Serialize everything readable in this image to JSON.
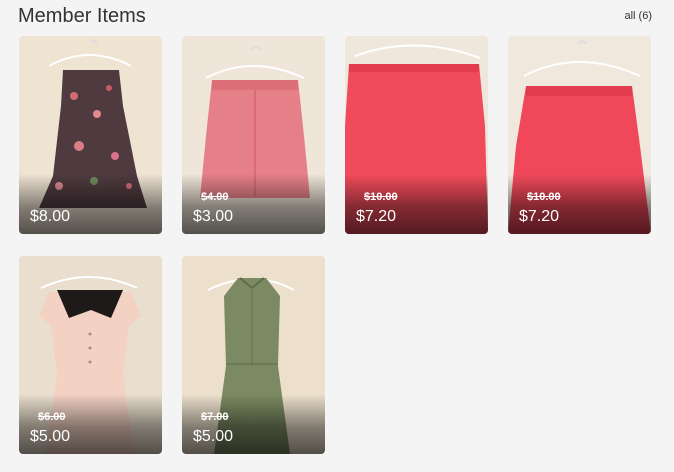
{
  "header": {
    "title": "Member Items",
    "all_label": "all (6)"
  },
  "items": [
    {
      "price": "$8.00",
      "old_price": "",
      "image": "floral-strapless-dress",
      "bg": "#efe3d2",
      "garment_color": "#4e3a3f"
    },
    {
      "price": "$3.00",
      "old_price": "$4.00",
      "image": "pink-skirt",
      "bg": "#efe5d8",
      "garment_color": "#e57f88"
    },
    {
      "price": "$7.20",
      "old_price": "$10.00",
      "image": "red-skirt",
      "bg": "#efe7dc",
      "garment_color": "#f04b5b"
    },
    {
      "price": "$7.20",
      "old_price": "$10.00",
      "image": "red-skirt",
      "bg": "#f0e8dd",
      "garment_color": "#f0485a"
    },
    {
      "price": "$5.00",
      "old_price": "$6.00",
      "image": "peach-dress-black-collar",
      "bg": "#eadfce",
      "garment_color": "#f3d2c4"
    },
    {
      "price": "$5.00",
      "old_price": "$7.00",
      "image": "olive-shirt-dress",
      "bg": "#ece0cc",
      "garment_color": "#7b8a62"
    }
  ]
}
